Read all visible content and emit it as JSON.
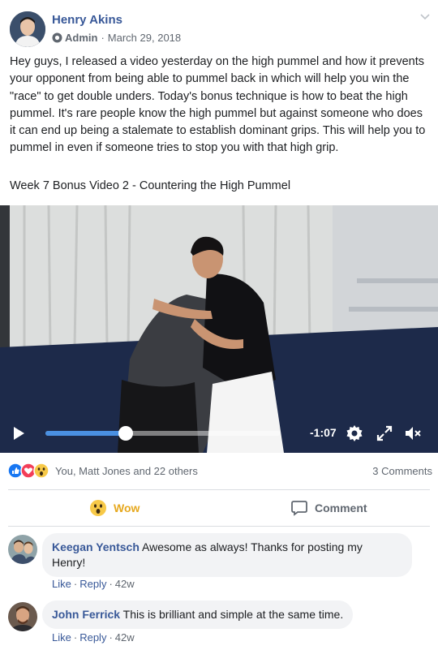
{
  "post": {
    "author": "Henry Akins",
    "role": "Admin",
    "separator": "·",
    "date": "March 29, 2018",
    "body": "Hey guys, I released a video yesterday on the high pummel and how it prevents your opponent from being able to pummel back in which will help you win the \"race\" to get double unders. Today's bonus technique is how to beat the high pummel. It's rare people know the high pummel but against someone who does it can end up being a stalemate to establish dominant grips. This will help you to pummel in even if someone tries to stop you with that high grip.",
    "subtitle": "Week 7 Bonus Video 2 - Countering the High Pummel"
  },
  "video": {
    "time_remaining": "-1:07",
    "progress_fraction": 0.34,
    "accent_color": "#4a90e2",
    "controls": {
      "play_icon": "play-icon",
      "settings_icon": "gear-icon",
      "fullscreen_icon": "expand-icon",
      "volume_icon": "muted-speaker-icon"
    }
  },
  "reactions": {
    "icons": [
      "like-icon",
      "love-icon",
      "wow-icon"
    ],
    "summary": "You, Matt Jones and 22 others",
    "comments_count": "3 Comments"
  },
  "actions": {
    "wow_label": "Wow",
    "comment_label": "Comment"
  },
  "comments": [
    {
      "author": "Keegan Yentsch",
      "text_line1": "Awesome as always! Thanks for posting my",
      "text_line2": "Henry!",
      "like": "Like",
      "reply": "Reply",
      "age": "42w"
    },
    {
      "author": "John Ferrick",
      "text_line1": "This is brilliant and simple at the same time.",
      "like": "Like",
      "reply": "Reply",
      "age": "42w"
    }
  ],
  "colors": {
    "link_blue": "#385898",
    "meta_gray": "#606770",
    "wow_yellow": "#e6a81e",
    "bubble_bg": "#f2f3f5"
  }
}
